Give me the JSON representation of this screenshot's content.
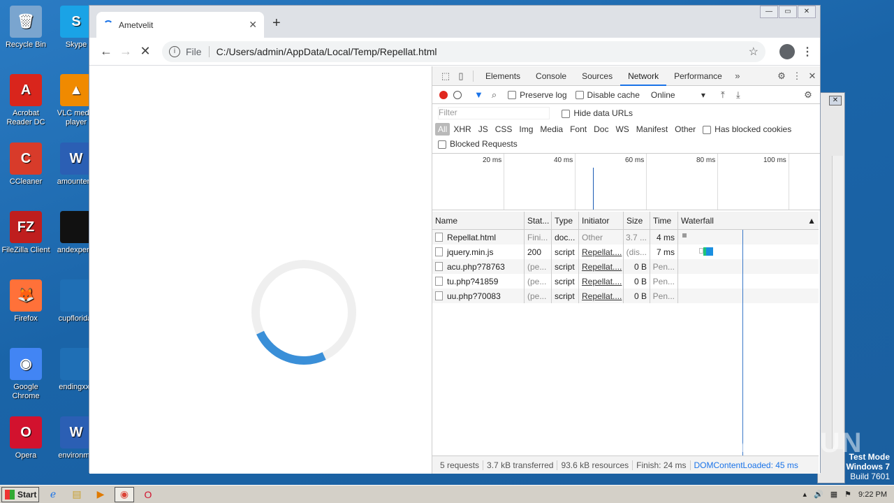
{
  "desktop": {
    "icons": [
      {
        "label": "Recycle Bin",
        "color": "#7aa5cf",
        "glyph": "🗑"
      },
      {
        "label": "Skype",
        "color": "#1aa3e6",
        "glyph": "S"
      },
      {
        "label": "Acrobat Reader DC",
        "color": "#d9251c",
        "glyph": "A"
      },
      {
        "label": "VLC media player",
        "color": "#f08a00",
        "glyph": "▲"
      },
      {
        "label": "CCleaner",
        "color": "#d83b2a",
        "glyph": "C"
      },
      {
        "label": "amountenc",
        "color": "#2b5fb4",
        "glyph": "W"
      },
      {
        "label": "FileZilla Client",
        "color": "#bf1e1e",
        "glyph": "FZ"
      },
      {
        "label": "andexperie",
        "color": "#111111",
        "glyph": ""
      },
      {
        "label": "Firefox",
        "color": "#ff7139",
        "glyph": "🦊"
      },
      {
        "label": "cupflorida.",
        "color": "#1f6fb5",
        "glyph": ""
      },
      {
        "label": "Google Chrome",
        "color": "#4285f4",
        "glyph": "◉"
      },
      {
        "label": "endingxxx",
        "color": "#1f6fb5",
        "glyph": ""
      },
      {
        "label": "Opera",
        "color": "#d2122e",
        "glyph": "O"
      },
      {
        "label": "environme",
        "color": "#2b5fb4",
        "glyph": "W"
      }
    ]
  },
  "browser": {
    "tab_title": "Ametvelit",
    "scheme": "File",
    "url": "C:/Users/admin/AppData/Local/Temp/Repellat.html"
  },
  "devtools": {
    "tabs": [
      "Elements",
      "Console",
      "Sources",
      "Network",
      "Performance"
    ],
    "active_tab": "Network",
    "toolbar": {
      "preserve_log": "Preserve log",
      "disable_cache": "Disable cache",
      "throttle": "Online"
    },
    "filter_placeholder": "Filter",
    "hide_data_urls": "Hide data URLs",
    "types": [
      "All",
      "XHR",
      "JS",
      "CSS",
      "Img",
      "Media",
      "Font",
      "Doc",
      "WS",
      "Manifest",
      "Other"
    ],
    "has_blocked_cookies": "Has blocked cookies",
    "blocked_requests": "Blocked Requests",
    "overview_ticks": [
      "20 ms",
      "40 ms",
      "60 ms",
      "80 ms",
      "100 ms"
    ],
    "columns": [
      "Name",
      "Stat...",
      "Type",
      "Initiator",
      "Size",
      "Time",
      "Waterfall"
    ],
    "requests": [
      {
        "name": "Repellat.html",
        "status": "Fini...",
        "type": "doc...",
        "initiator": "Other",
        "size": "3.7 ...",
        "time": "4 ms"
      },
      {
        "name": "jquery.min.js",
        "status": "200",
        "type": "script",
        "initiator": "Repellat....",
        "size": "(dis...",
        "time": "7 ms"
      },
      {
        "name": "acu.php?78763",
        "status": "(pe...",
        "type": "script",
        "initiator": "Repellat....",
        "size": "0 B",
        "time": "Pen..."
      },
      {
        "name": "tu.php?41859",
        "status": "(pe...",
        "type": "script",
        "initiator": "Repellat....",
        "size": "0 B",
        "time": "Pen..."
      },
      {
        "name": "uu.php?70083",
        "status": "(pe...",
        "type": "script",
        "initiator": "Repellat....",
        "size": "0 B",
        "time": "Pen..."
      }
    ],
    "status": {
      "requests": "5 requests",
      "transferred": "3.7 kB transferred",
      "resources": "93.6 kB resources",
      "finish": "Finish: 24 ms",
      "dcl": "DOMContentLoaded: 45 ms"
    }
  },
  "watermark": "ANY RUN",
  "test_mode": {
    "line1": "Test Mode",
    "line2": "Windows 7",
    "line3": "Build 7601"
  },
  "taskbar": {
    "start": "Start",
    "time": "9:22 PM"
  },
  "colors": {
    "accent": "#1a73e8",
    "record": "#e0281f",
    "desktop": "#1f6fb5"
  }
}
